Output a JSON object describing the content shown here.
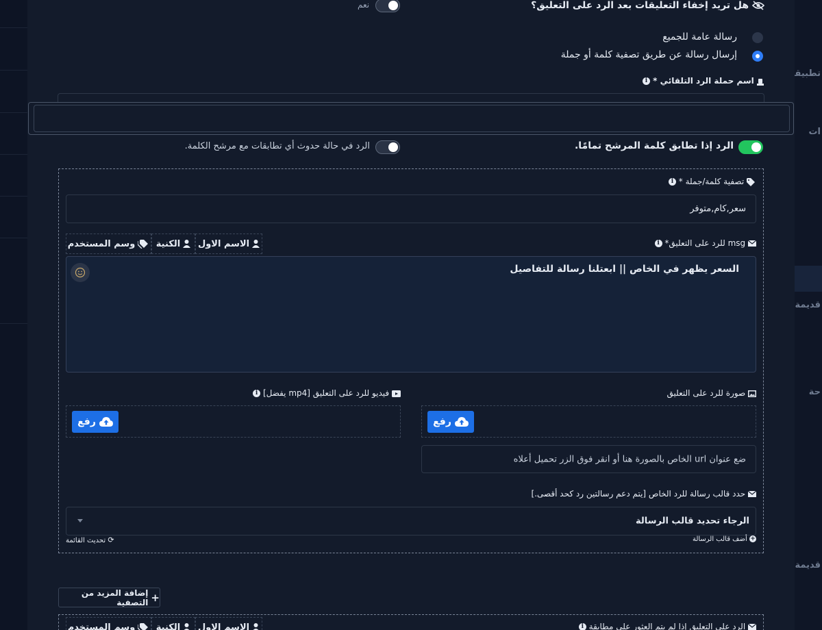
{
  "background": {
    "right_labels": [
      "تطبيقات",
      "ات",
      "قديمة",
      "حة",
      "قديمة"
    ]
  },
  "hide_comments": {
    "question": "هل تريد إخفاء التعليقات بعد الرد على التعليق؟",
    "toggle_label": "نعم",
    "enabled": true
  },
  "message_type": {
    "options": [
      {
        "label": "رسالة عامة للجميع",
        "selected": false
      },
      {
        "label": "إرسال رسالة عن طريق تصفية كلمة أو جملة",
        "selected": true
      }
    ]
  },
  "campaign_name": {
    "label": "اسم حملة الرد التلقائي *",
    "value": ""
  },
  "match_options": {
    "exact_label": "الرد إذا تطابق كلمة المرشح تمامًا.",
    "exact_on": true,
    "partial_label": "الرد في حالة حدوث أي تطابقات مع مرشح الكلمة.",
    "partial_on": true
  },
  "filter_block": {
    "filter_label": "تصفية كلمة/جملة *",
    "filter_value": "سعر,كام,متوفر",
    "msg_label": "msg للرد على التعليق*",
    "tags": [
      "وسم المستخدم",
      "الكنية",
      "الاسم الاول"
    ],
    "msg_value": "السعر يظهر في الخاص || ابعتلنا رسالة للتفاصيل",
    "video_label": "فيديو للرد على التعليق [mp4 يفضل]",
    "image_label": "صورة للرد على التعليق",
    "upload_label": "رفع",
    "image_url_placeholder": "ضع عنوان url الخاص بالصورة هنا أو انقر فوق الزر تحميل أعلاه",
    "template_label": "حدد قالب رسالة للرد الخاص [يتم دعم رسالتين رد كحد أقصى.]",
    "template_placeholder": "الرجاء تحديد قالب الرسالة",
    "refresh_label": "تحديث القائمة",
    "add_template_label": "أضف قالب الرسالة"
  },
  "add_more_label": "إضافة المزيد من التصفية",
  "no_match": {
    "label": "الرد على التعليق إذا لم يتم العثور على مطابقة",
    "tags": [
      "وسم المستخدم",
      "الكنية",
      "الاسم الاول"
    ]
  },
  "colors": {
    "accent": "#1d6fe6",
    "toggle_on": "#22c55e",
    "panel": "#131b2b",
    "page": "#0b1120"
  }
}
